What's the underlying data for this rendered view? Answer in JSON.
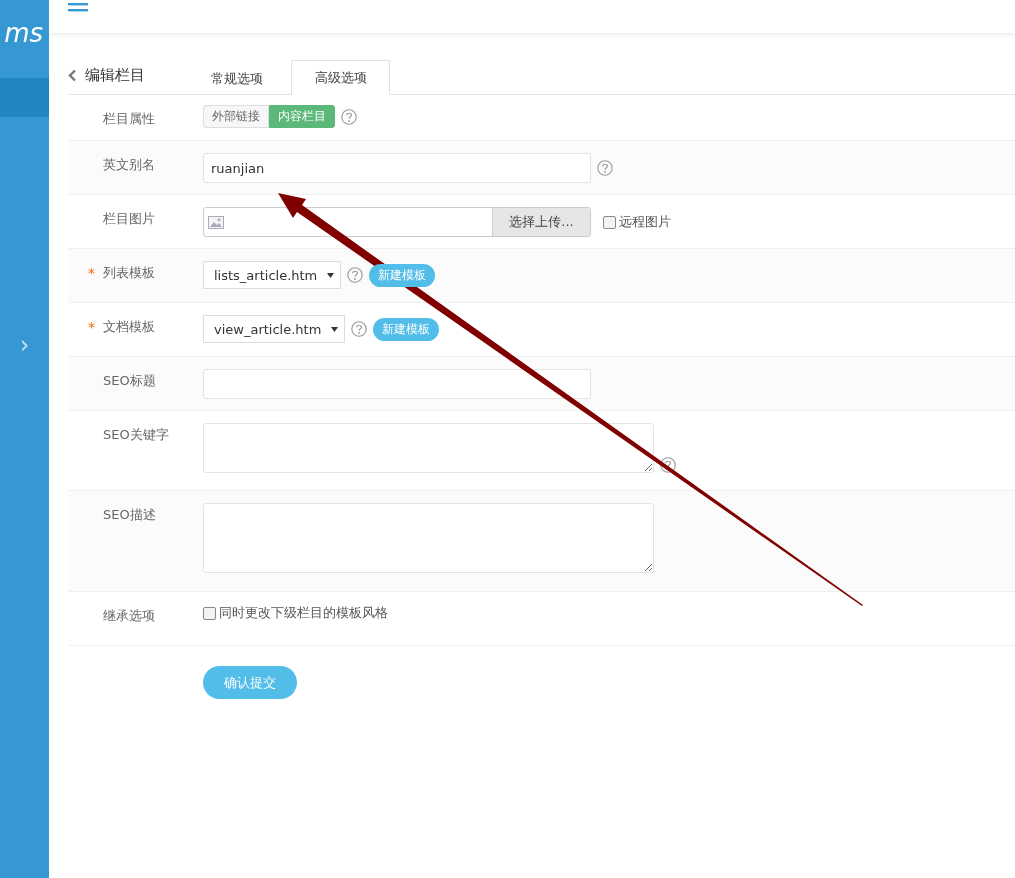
{
  "sidebar": {
    "logo_text": "ms",
    "expand_icon": "›"
  },
  "page": {
    "back_title": "编辑栏目"
  },
  "tabs": [
    {
      "label": "常规选项",
      "selected": false
    },
    {
      "label": "高级选项",
      "selected": true
    }
  ],
  "form": [
    {
      "kind": "toggle",
      "label": "栏目属性",
      "help": true,
      "options": [
        {
          "label": "外部链接",
          "selected": false
        },
        {
          "label": "内容栏目",
          "selected": true
        }
      ]
    },
    {
      "kind": "text",
      "label": "英文别名",
      "help": true,
      "value": "ruanjian"
    },
    {
      "kind": "image",
      "label": "栏目图片",
      "help": false,
      "button": "选择上传...",
      "remote": {
        "label": "远程图片",
        "checked": false
      }
    },
    {
      "kind": "select",
      "label": "列表模板",
      "required_mark": "*",
      "help": true,
      "value": "lists_article.htm",
      "button": "新建模板"
    },
    {
      "kind": "select",
      "label": "文档模板",
      "required_mark": "*",
      "help": true,
      "value": "view_article.htm",
      "button": "新建模板"
    },
    {
      "kind": "text",
      "label": "SEO标题",
      "help": false
    },
    {
      "kind": "textarea",
      "label": "SEO关键字",
      "help": true
    },
    {
      "kind": "textarea",
      "label": "SEO描述",
      "help": false
    },
    {
      "kind": "checkbox",
      "label": "继承选项",
      "help": false,
      "option": {
        "label": "同时更改下级栏目的模板风格",
        "checked": false
      }
    }
  ],
  "submit": "确认提交"
}
